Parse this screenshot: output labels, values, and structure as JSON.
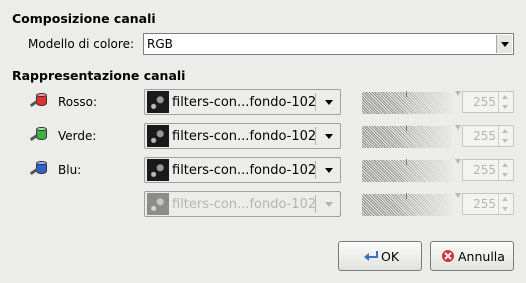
{
  "composition": {
    "title": "Composizione canali",
    "color_model_label": "Modello di colore:",
    "color_model_value": "RGB"
  },
  "channels": {
    "title": "Rappresentazione canali",
    "rows": [
      {
        "label": "Rosso:",
        "color": "#e03030",
        "layer": "filters-con...fondo-102",
        "value": "255",
        "enabled": true
      },
      {
        "label": "Verde:",
        "color": "#40b040",
        "layer": "filters-con...fondo-102",
        "value": "255",
        "enabled": true
      },
      {
        "label": "Blu:",
        "color": "#3060d0",
        "layer": "filters-con...fondo-102",
        "value": "255",
        "enabled": true
      },
      {
        "label": "",
        "color": "",
        "layer": "filters-con...fondo-102",
        "value": "255",
        "enabled": false
      }
    ]
  },
  "buttons": {
    "ok": "OK",
    "cancel": "Annulla"
  }
}
